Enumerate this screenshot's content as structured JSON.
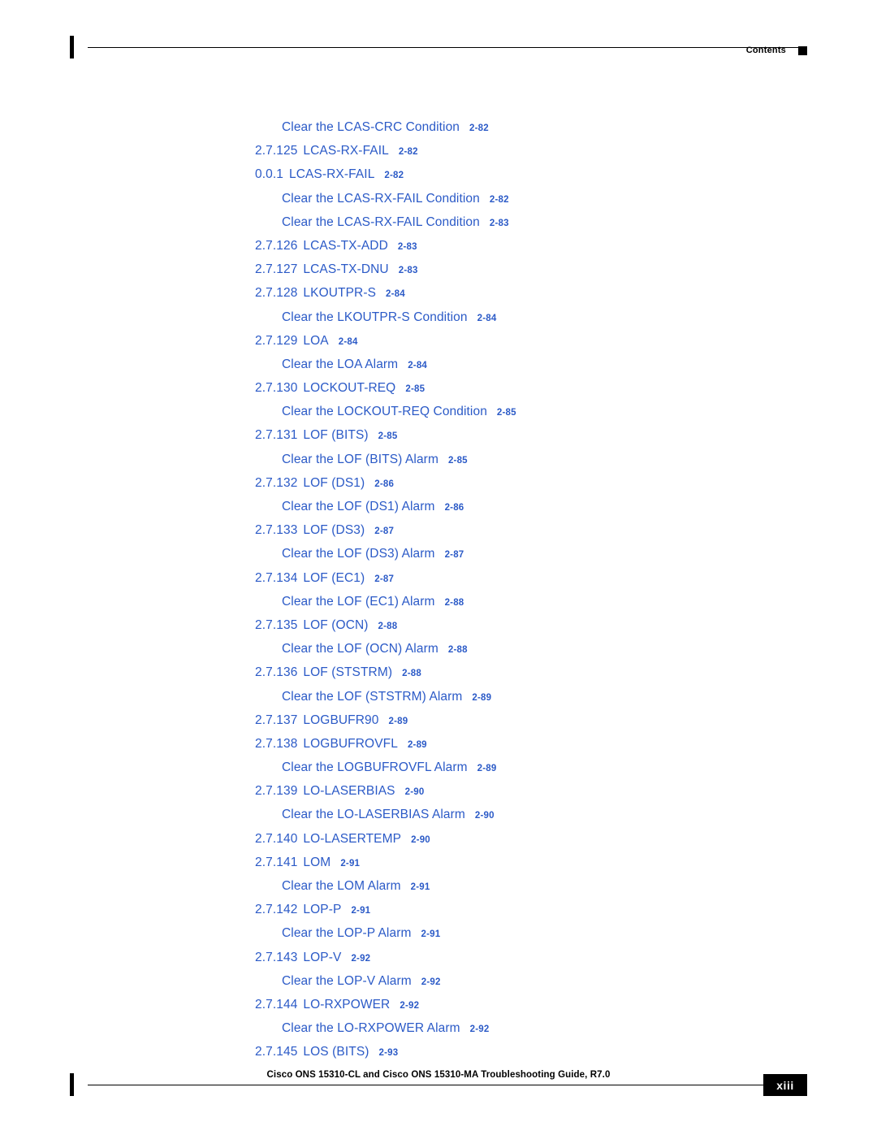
{
  "header": {
    "label": "Contents"
  },
  "footer": {
    "title": "Cisco ONS 15310-CL and Cisco ONS 15310-MA Troubleshooting Guide, R7.0",
    "page": "xiii"
  },
  "toc": {
    "entries": [
      {
        "level": 2,
        "num": "",
        "title": "Clear the LCAS-CRC Condition",
        "page": "2-82"
      },
      {
        "level": 1,
        "num": "2.7.125",
        "title": "LCAS-RX-FAIL",
        "page": "2-82"
      },
      {
        "level": 1,
        "num": "0.0.1",
        "title": "LCAS-RX-FAIL",
        "page": "2-82"
      },
      {
        "level": 2,
        "num": "",
        "title": "Clear the LCAS-RX-FAIL Condition",
        "page": "2-82"
      },
      {
        "level": 2,
        "num": "",
        "title": "Clear the LCAS-RX-FAIL Condition",
        "page": "2-83"
      },
      {
        "level": 1,
        "num": "2.7.126",
        "title": "LCAS-TX-ADD",
        "page": "2-83"
      },
      {
        "level": 1,
        "num": "2.7.127",
        "title": "LCAS-TX-DNU",
        "page": "2-83"
      },
      {
        "level": 1,
        "num": "2.7.128",
        "title": "LKOUTPR-S",
        "page": "2-84"
      },
      {
        "level": 2,
        "num": "",
        "title": "Clear the LKOUTPR-S Condition",
        "page": "2-84"
      },
      {
        "level": 1,
        "num": "2.7.129",
        "title": "LOA",
        "page": "2-84"
      },
      {
        "level": 2,
        "num": "",
        "title": "Clear the LOA Alarm",
        "page": "2-84"
      },
      {
        "level": 1,
        "num": "2.7.130",
        "title": "LOCKOUT-REQ",
        "page": "2-85"
      },
      {
        "level": 2,
        "num": "",
        "title": "Clear the LOCKOUT-REQ Condition",
        "page": "2-85"
      },
      {
        "level": 1,
        "num": "2.7.131",
        "title": "LOF (BITS)",
        "page": "2-85"
      },
      {
        "level": 2,
        "num": "",
        "title": "Clear the LOF (BITS) Alarm",
        "page": "2-85"
      },
      {
        "level": 1,
        "num": "2.7.132",
        "title": "LOF (DS1)",
        "page": "2-86"
      },
      {
        "level": 2,
        "num": "",
        "title": "Clear the LOF (DS1) Alarm",
        "page": "2-86"
      },
      {
        "level": 1,
        "num": "2.7.133",
        "title": "LOF (DS3)",
        "page": "2-87"
      },
      {
        "level": 2,
        "num": "",
        "title": "Clear the LOF (DS3) Alarm",
        "page": "2-87"
      },
      {
        "level": 1,
        "num": "2.7.134",
        "title": "LOF (EC1)",
        "page": "2-87"
      },
      {
        "level": 2,
        "num": "",
        "title": "Clear the LOF (EC1) Alarm",
        "page": "2-88"
      },
      {
        "level": 1,
        "num": "2.7.135",
        "title": "LOF (OCN)",
        "page": "2-88"
      },
      {
        "level": 2,
        "num": "",
        "title": "Clear the LOF (OCN) Alarm",
        "page": "2-88"
      },
      {
        "level": 1,
        "num": "2.7.136",
        "title": "LOF (STSTRM)",
        "page": "2-88"
      },
      {
        "level": 2,
        "num": "",
        "title": "Clear the LOF (STSTRM) Alarm",
        "page": "2-89"
      },
      {
        "level": 1,
        "num": "2.7.137",
        "title": "LOGBUFR90",
        "page": "2-89"
      },
      {
        "level": 1,
        "num": "2.7.138",
        "title": "LOGBUFROVFL",
        "page": "2-89"
      },
      {
        "level": 2,
        "num": "",
        "title": "Clear the LOGBUFROVFL Alarm",
        "page": "2-89"
      },
      {
        "level": 1,
        "num": "2.7.139",
        "title": "LO-LASERBIAS",
        "page": "2-90"
      },
      {
        "level": 2,
        "num": "",
        "title": "Clear the LO-LASERBIAS Alarm",
        "page": "2-90"
      },
      {
        "level": 1,
        "num": "2.7.140",
        "title": "LO-LASERTEMP",
        "page": "2-90"
      },
      {
        "level": 1,
        "num": "2.7.141",
        "title": "LOM",
        "page": "2-91"
      },
      {
        "level": 2,
        "num": "",
        "title": "Clear the LOM Alarm",
        "page": "2-91"
      },
      {
        "level": 1,
        "num": "2.7.142",
        "title": "LOP-P",
        "page": "2-91"
      },
      {
        "level": 2,
        "num": "",
        "title": "Clear the LOP-P Alarm",
        "page": "2-91"
      },
      {
        "level": 1,
        "num": "2.7.143",
        "title": "LOP-V",
        "page": "2-92"
      },
      {
        "level": 2,
        "num": "",
        "title": "Clear the LOP-V Alarm",
        "page": "2-92"
      },
      {
        "level": 1,
        "num": "2.7.144",
        "title": "LO-RXPOWER",
        "page": "2-92"
      },
      {
        "level": 2,
        "num": "",
        "title": "Clear the LO-RXPOWER Alarm",
        "page": "2-92"
      },
      {
        "level": 1,
        "num": "2.7.145",
        "title": "LOS (BITS)",
        "page": "2-93"
      }
    ]
  }
}
